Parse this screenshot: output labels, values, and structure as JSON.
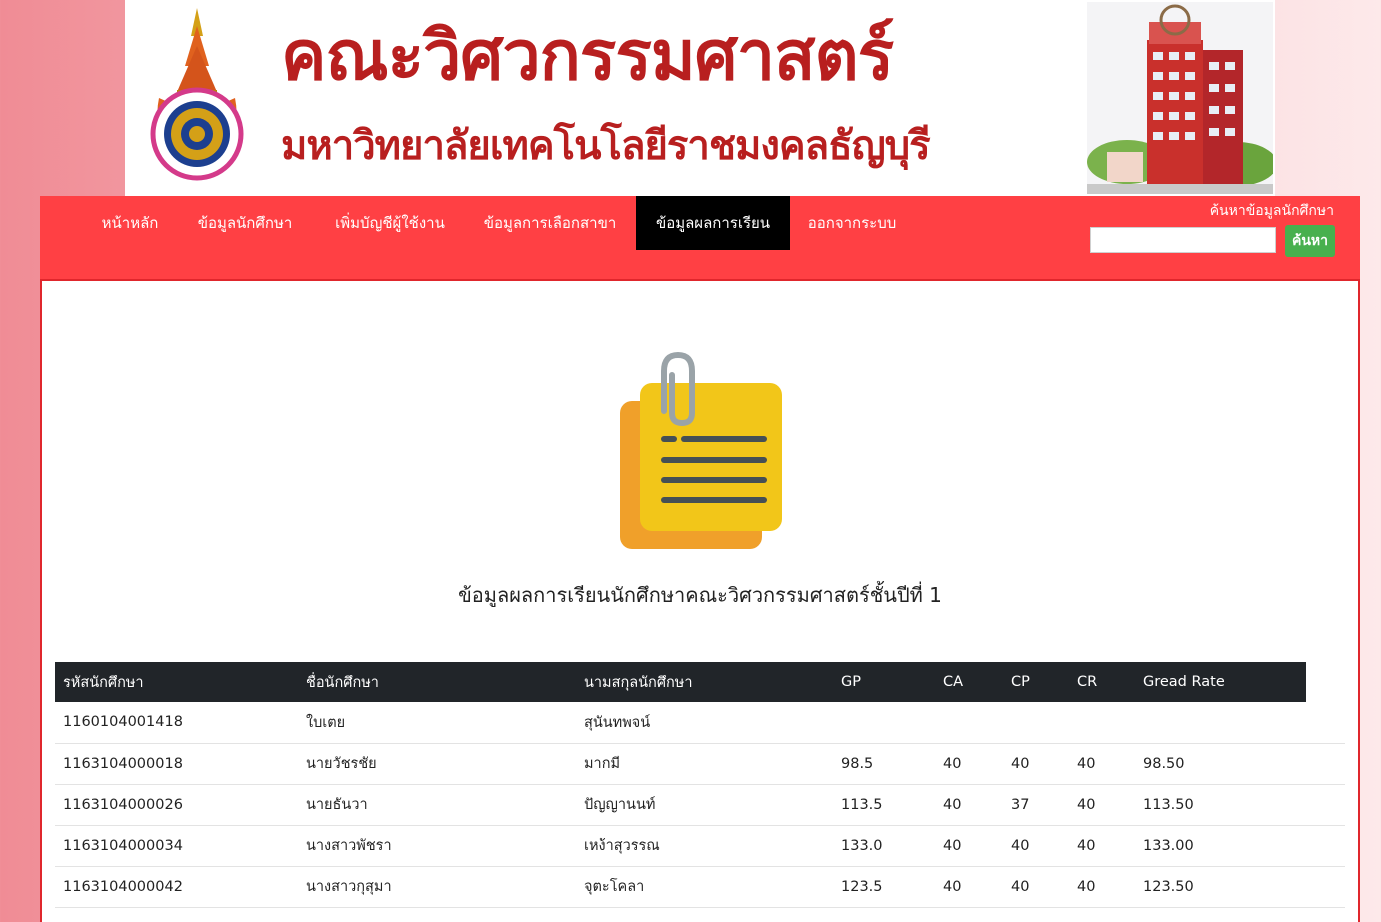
{
  "banner": {
    "title": "คณะวิศวกรรมศาสตร์",
    "subtitle": "มหาวิทยาลัยเทคโนโลยีราชมงคลธัญบุรี",
    "logo_icon": "university-seal-icon",
    "building_image": "faculty-building-image",
    "title_color": "#b81f1f"
  },
  "nav": {
    "items": [
      {
        "label": "หน้าหลัก"
      },
      {
        "label": "ข้อมูลนักศึกษา"
      },
      {
        "label": "เพิ่มบัญชีผู้ใช้งาน"
      },
      {
        "label": "ข้อมูลการเลือกสาขา"
      },
      {
        "label": "ข้อมูลผลการเรียน",
        "active": true
      },
      {
        "label": "ออกจากระบบ"
      }
    ],
    "background": "#ff4044",
    "active_background": "#000000"
  },
  "search": {
    "label": "ค้นหาข้อมูลนักศึกษา",
    "value": "",
    "button_label": "ค้นหา",
    "button_color": "#48b04e"
  },
  "main": {
    "icon": "sticky-notes-icon",
    "heading": "ข้อมูลผลการเรียนนักศึกษาคณะวิศวกรรมศาสตร์ชั้นปีที่ 1",
    "table": {
      "columns": [
        "รหัสนักศึกษา",
        "ชื่อนักศึกษา",
        "นามสกุลนักศึกษา",
        "GP",
        "CA",
        "CP",
        "CR",
        "Gread Rate"
      ],
      "rows": [
        [
          "1160104001418",
          "ใบเตย",
          "สุนันทพจน์",
          "",
          "",
          "",
          "",
          ""
        ],
        [
          "1163104000018",
          "นายวัชรชัย",
          "มากมี",
          "98.5",
          "40",
          "40",
          "40",
          "98.50"
        ],
        [
          "1163104000026",
          "นายธันวา",
          "ปัญญานนท์",
          "113.5",
          "40",
          "37",
          "40",
          "113.50"
        ],
        [
          "1163104000034",
          "นางสาวพัชรา",
          "เหง้าสุวรรณ",
          "133.0",
          "40",
          "40",
          "40",
          "133.00"
        ],
        [
          "1163104000042",
          "นางสาวกุสุมา",
          "จุตะโคลา",
          "123.5",
          "40",
          "40",
          "40",
          "123.50"
        ]
      ]
    }
  }
}
